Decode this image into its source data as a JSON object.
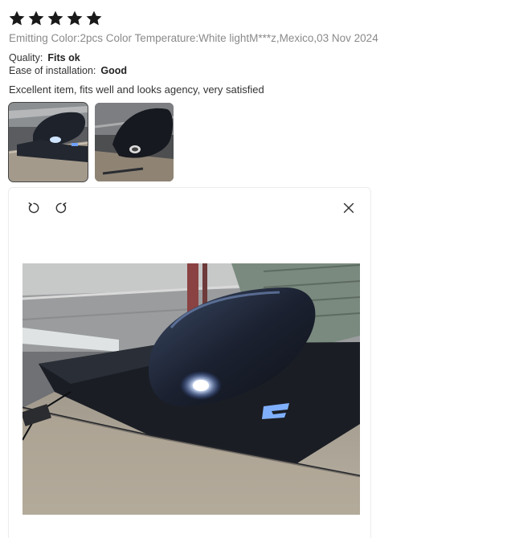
{
  "review": {
    "rating": 5,
    "meta": "Emitting Color:2pcs Color Temperature:White lightM***z,Mexico,03 Nov 2024",
    "attributes": [
      {
        "key": "Quality:",
        "value": "Fits ok"
      },
      {
        "key": "Ease of installation:",
        "value": "Good"
      }
    ],
    "text": "Excellent item, fits well and looks agency, very satisfied",
    "photos_count": 2
  },
  "viewer": {
    "rotate_left_icon": "rotate-left-icon",
    "rotate_right_icon": "rotate-right-icon",
    "close_icon": "close-icon",
    "badge_text": "LINE"
  },
  "colors": {
    "star": "#191919",
    "meta_text": "#8a8a8a",
    "accent_light": "#cfe4ff"
  }
}
